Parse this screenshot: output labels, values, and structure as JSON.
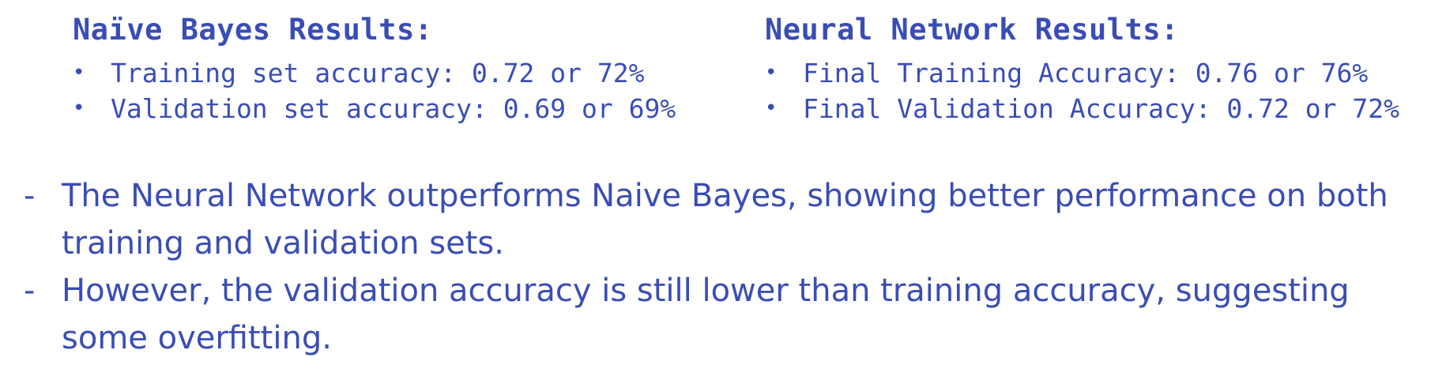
{
  "naive_bayes": {
    "title": "Naïve Bayes Results:",
    "bullet": "•",
    "items": [
      "Training set accuracy: 0.72 or 72%",
      "Validation set accuracy: 0.69 or 69%"
    ]
  },
  "neural_network": {
    "title": "Neural Network Results:",
    "bullet": "•",
    "items": [
      "Final Training Accuracy: 0.76 or 76%",
      "Final Validation Accuracy: 0.72 or 72%"
    ]
  },
  "notes": {
    "marker": "-",
    "items": [
      "The Neural Network outperforms Naive Bayes, showing better performance on both training and validation sets.",
      "However, the validation accuracy is still lower than training accuracy, suggesting some overfitting."
    ]
  },
  "colors": {
    "text": "#3a4db5",
    "background": "#ffffff"
  }
}
